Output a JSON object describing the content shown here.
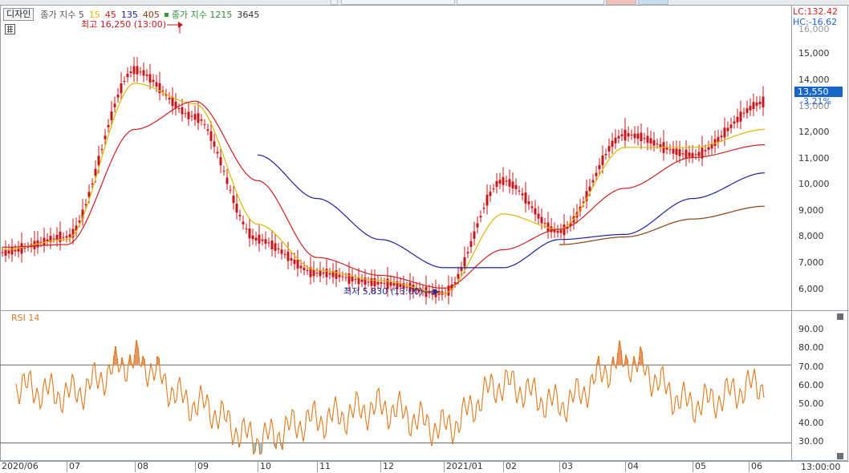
{
  "legend": {
    "design_button": "디자인",
    "main_label": "종가 지수 5",
    "ma": [
      {
        "label": "15",
        "color": "#e0b800"
      },
      {
        "label": "45",
        "color": "#d01f1f"
      },
      {
        "label": "135",
        "color": "#1b1fa6"
      },
      {
        "label": "405",
        "color": "#8a3e10"
      }
    ],
    "volume_label": "종가 지수 1215",
    "volume_value": "3645"
  },
  "price_axis": {
    "ticks": [
      "15,000",
      "14,000",
      "13,000",
      "12,000",
      "11,000",
      "10,000",
      "9,000",
      "8,000",
      "7,000",
      "6,000"
    ],
    "top_partial": "16,000",
    "lc": "LC:132.42",
    "hc": "HC:-16.62",
    "current_price": "13,550",
    "current_change": "-3.21%",
    "current_under": "13,000"
  },
  "annotations": {
    "high": "최고 16,250 (13:00)",
    "low": "최저 5,830 (13:00)"
  },
  "rsi": {
    "title": "RSI 14",
    "ticks": [
      "90.00",
      "80.00",
      "70.00",
      "60.00",
      "50.00",
      "40.00",
      "30.00"
    ]
  },
  "xaxis": {
    "labels": [
      "2020/06",
      "07",
      "08",
      "09",
      "10",
      "11",
      "12",
      "2021/01",
      "02",
      "03",
      "04",
      "05",
      "06"
    ],
    "time": "13:00:00"
  },
  "colors": {
    "candle": "#c2181d",
    "ma5": "#2b2b2b",
    "ma15": "#e0b800",
    "ma45": "#d01f1f",
    "ma135": "#1b1fa6",
    "ma405": "#8a3e10",
    "rsi": "#e07a1d",
    "rsi_fill_high": "#e8956a",
    "rsi_fill_low": "#8fc7ea"
  },
  "chart_data": [
    {
      "type": "line",
      "title": "",
      "ylim": [
        5500,
        16300
      ],
      "x": [
        "2020/06",
        "07",
        "08",
        "09",
        "10",
        "11",
        "12",
        "2021/01",
        "02",
        "03",
        "04",
        "05",
        "06"
      ],
      "series": [
        {
          "name": "종가 지수 5",
          "values": [
            7700,
            8300,
            14800,
            13000,
            8200,
            6900,
            6500,
            6100,
            10500,
            8500,
            12300,
            11500,
            13550
          ]
        },
        {
          "name": "15",
          "values": [
            7800,
            8200,
            14300,
            13500,
            8800,
            7000,
            6600,
            6100,
            9200,
            8600,
            11800,
            11800,
            12500
          ]
        },
        {
          "name": "45",
          "values": [
            7900,
            8000,
            12500,
            13600,
            10500,
            7500,
            6800,
            6300,
            7800,
            8600,
            10200,
            11400,
            11900
          ]
        },
        {
          "name": "135",
          "values": [
            null,
            null,
            null,
            null,
            11500,
            9800,
            8200,
            7100,
            7100,
            8200,
            8400,
            9800,
            10800
          ]
        },
        {
          "name": "405",
          "values": [
            null,
            null,
            null,
            null,
            null,
            null,
            null,
            null,
            null,
            8000,
            8300,
            9000,
            9500
          ]
        }
      ],
      "high": 16250,
      "low": 5830,
      "current": 13550,
      "change_pct": -3.21
    },
    {
      "type": "line",
      "title": "RSI 14",
      "ylim": [
        22,
        96
      ],
      "x": [
        "2020/06",
        "07",
        "08",
        "09",
        "10",
        "11",
        "12",
        "2021/01",
        "02",
        "03",
        "04",
        "05",
        "06"
      ],
      "reference_lines": [
        70,
        30
      ],
      "series": [
        {
          "name": "RSI 14",
          "values": [
            60,
            55,
            72,
            50,
            32,
            42,
            48,
            38,
            60,
            50,
            72,
            50,
            60
          ]
        }
      ]
    }
  ]
}
